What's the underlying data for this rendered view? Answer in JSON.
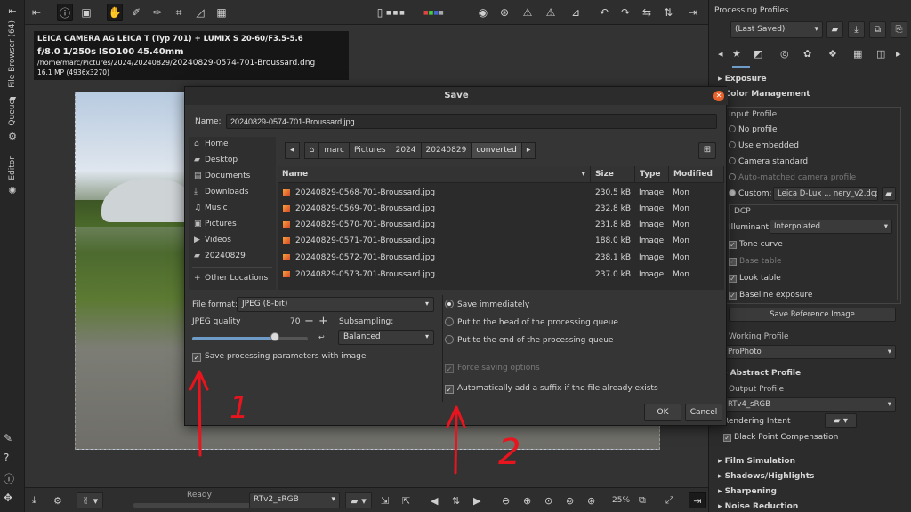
{
  "left_tabs": {
    "file_browser": "File Browser (64)",
    "queue": "Queue",
    "editor": "Editor"
  },
  "photo_info": {
    "camera": "LEICA CAMERA AG LEICA T (Typ 701) + LUMIX S 20-60/F3.5-5.6",
    "aperture": "f/8.0",
    "shutter": "1/250s",
    "iso": "ISO100",
    "focal": "45.40mm",
    "path_dir": "/home/marc/Pictures/2024/20240829/",
    "path_file": "20240829-0574-701-Broussard.dng",
    "resolution": "16.1 MP (4936x3270)"
  },
  "status": {
    "ready": "Ready",
    "profile": "RTv2_sRGB",
    "zoom": "25%"
  },
  "right_panel": {
    "title": "Processing Profiles",
    "profile_select": "(Last Saved)",
    "exposure": "Exposure",
    "color_management": "Color Management",
    "input_profile": "Input Profile",
    "no_profile": "No profile",
    "use_embedded": "Use embedded",
    "camera_standard": "Camera standard",
    "auto_matched": "Auto-matched camera profile",
    "custom_label": "Custom:",
    "custom_value": "Leica D-Lux ... nery_v2.dcp",
    "dcp": "DCP",
    "illuminant_label": "Illuminant:",
    "illuminant_value": "Interpolated",
    "tone_curve": "Tone curve",
    "base_table": "Base table",
    "look_table": "Look table",
    "baseline_exposure": "Baseline exposure",
    "save_reference": "Save Reference Image",
    "working_profile": "Working Profile",
    "working_value": "ProPhoto",
    "abstract_profile": "Abstract Profile",
    "output_profile": "Output Profile",
    "output_value": "RTv4_sRGB",
    "rendering_intent": "Rendering Intent",
    "black_point": "Black Point Compensation",
    "film_simulation": "Film Simulation",
    "shadows_highlights": "Shadows/Highlights",
    "sharpening": "Sharpening",
    "noise_reduction": "Noise Reduction"
  },
  "dialog": {
    "title": "Save",
    "name_label": "Name:",
    "name_value": "20240829-0574-701-Broussard.jpg",
    "places": [
      "Home",
      "Desktop",
      "Documents",
      "Downloads",
      "Music",
      "Pictures",
      "Videos",
      "20240829"
    ],
    "other_locations": "Other Locations",
    "path": [
      "marc",
      "Pictures",
      "2024",
      "20240829",
      "converted"
    ],
    "columns": {
      "name": "Name",
      "size": "Size",
      "type": "Type",
      "modified": "Modified"
    },
    "files": [
      {
        "name": "20240829-0568-701-Broussard.jpg",
        "size": "230.5 kB",
        "type": "Image",
        "modified": "Mon"
      },
      {
        "name": "20240829-0569-701-Broussard.jpg",
        "size": "232.8 kB",
        "type": "Image",
        "modified": "Mon"
      },
      {
        "name": "20240829-0570-701-Broussard.jpg",
        "size": "231.8 kB",
        "type": "Image",
        "modified": "Mon"
      },
      {
        "name": "20240829-0571-701-Broussard.jpg",
        "size": "188.0 kB",
        "type": "Image",
        "modified": "Mon"
      },
      {
        "name": "20240829-0572-701-Broussard.jpg",
        "size": "238.1 kB",
        "type": "Image",
        "modified": "Mon"
      },
      {
        "name": "20240829-0573-701-Broussard.jpg",
        "size": "237.0 kB",
        "type": "Image",
        "modified": "Mon"
      }
    ],
    "file_format_label": "File format:",
    "file_format_value": "JPEG (8-bit)",
    "jpeg_quality_label": "JPEG quality",
    "jpeg_quality_value": "70",
    "subsampling_label": "Subsampling:",
    "subsampling_value": "Balanced",
    "save_params": "Save processing parameters with image",
    "save_immediately": "Save immediately",
    "queue_head": "Put to the head of the processing queue",
    "queue_end": "Put to the end of the processing queue",
    "force_saving": "Force saving options",
    "auto_suffix": "Automatically add a suffix if the file already exists",
    "ok": "OK",
    "cancel": "Cancel"
  },
  "annotations": {
    "label_1": "1",
    "label_2": "2",
    "color": "#e8141e"
  }
}
